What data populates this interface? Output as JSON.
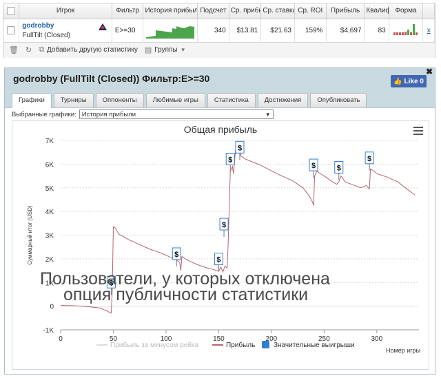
{
  "stats_table": {
    "columns": [
      "Игрок",
      "Фильтр",
      "История прибыли",
      "Подсчет",
      "Ср. прибыль",
      "Ср. ставка",
      "Ср. ROI",
      "Прибыль",
      "Квалиф.",
      "Форма"
    ],
    "row": {
      "player": "godrobby",
      "room": "FullTilt (Closed)",
      "filter": "E>=30",
      "count": "340",
      "avg_profit": "$13.81",
      "avg_stake": "$21.63",
      "avg_roi": "159%",
      "profit": "$4,697",
      "ability": "83",
      "remove": "x"
    },
    "toolbar": {
      "add_label": "Добавить другую статистику",
      "groups_label": "Группы"
    }
  },
  "panel": {
    "title": "godrobby (FullTilt (Closed)) Фильтр:E>=30",
    "like_label": "Like 0",
    "tabs": [
      "Графики",
      "Турниры",
      "Оппоненты",
      "Любимые игры",
      "Статистика",
      "Достижения",
      "Опубликовать"
    ],
    "active_tab": 0,
    "graph_select_label": "Выбранные графики:",
    "graph_select_value": "История прибыли",
    "watermark_line1": "Пользователи, у которых отключена",
    "watermark_line2": "опция публичности статистики"
  },
  "colors": {
    "profit_line": "#b5646c",
    "rake_line": "#dddddd",
    "big_win": "#2f7fd6",
    "sparkline": "#4ca44c"
  },
  "chart_data": {
    "type": "line",
    "title": "Общая прибыль",
    "ylabel": "Суммарный итог (USD)",
    "xlabel": "Номер игры",
    "ylim": [
      -1000,
      7000
    ],
    "xlim": [
      0,
      340
    ],
    "yticks": [
      -1000,
      0,
      1000,
      2000,
      3000,
      4000,
      5000,
      6000,
      7000
    ],
    "ytick_labels": [
      "-1K",
      "0",
      "1K",
      "2K",
      "3K",
      "4K",
      "5K",
      "6K",
      "7K"
    ],
    "xticks": [
      0,
      50,
      100,
      150,
      200,
      250,
      300
    ],
    "legend": [
      "Прибыль за минусом рейка",
      "Прибыль",
      "Значительные выигрыши"
    ],
    "legend_position": "bottom",
    "series": [
      {
        "name": "Прибыль",
        "x": [
          0,
          10,
          20,
          30,
          38,
          41,
          44,
          46,
          47,
          48,
          49,
          50,
          52,
          55,
          65,
          75,
          85,
          95,
          105,
          110,
          113,
          114,
          115,
          120,
          130,
          140,
          145,
          148,
          150,
          152,
          154,
          156,
          158,
          159,
          161,
          163,
          164,
          166,
          168,
          170,
          171,
          176,
          190,
          205,
          220,
          230,
          236,
          239,
          240,
          241,
          243,
          250,
          258,
          262,
          264,
          266,
          270,
          285,
          290,
          293,
          294,
          296,
          300,
          310,
          320,
          330,
          336
        ],
        "y": [
          30,
          20,
          0,
          -40,
          -80,
          -150,
          -200,
          -260,
          -280,
          -300,
          650,
          3350,
          3300,
          3050,
          2800,
          2600,
          2400,
          2250,
          2050,
          1950,
          1850,
          1500,
          2100,
          1950,
          1750,
          1600,
          1550,
          1500,
          1480,
          1650,
          1450,
          1700,
          1600,
          2700,
          5700,
          5900,
          5600,
          6600,
          6500,
          6700,
          6350,
          6200,
          5950,
          5600,
          5300,
          5000,
          4650,
          4400,
          4250,
          5500,
          5700,
          5500,
          5250,
          5150,
          5250,
          5500,
          5250,
          5000,
          5100,
          4950,
          5800,
          5750,
          5600,
          5450,
          5250,
          4900,
          4700
        ]
      },
      {
        "name": "Прибыль за минусом рейка",
        "x": [
          0,
          336
        ],
        "y": [
          0,
          0
        ]
      }
    ],
    "big_wins": [
      {
        "x": 48,
        "y": 1000
      },
      {
        "x": 110,
        "y": 2200
      },
      {
        "x": 150,
        "y": 1980
      },
      {
        "x": 155,
        "y": 3450
      },
      {
        "x": 161,
        "y": 6200
      },
      {
        "x": 170,
        "y": 6700
      },
      {
        "x": 240,
        "y": 5950
      },
      {
        "x": 264,
        "y": 5850
      },
      {
        "x": 293,
        "y": 6250
      }
    ]
  }
}
